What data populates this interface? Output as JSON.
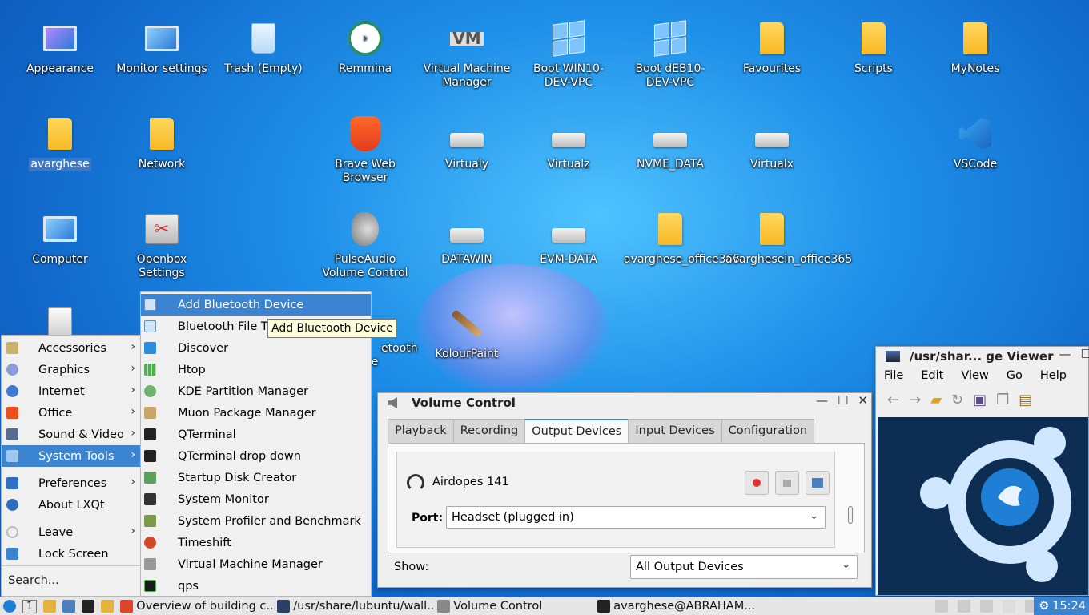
{
  "desktop": {
    "icons": [
      {
        "label": "Appearance"
      },
      {
        "label": "Monitor settings"
      },
      {
        "label": "Trash (Empty)"
      },
      {
        "label": "Remmina"
      },
      {
        "label": "Virtual Machine Manager"
      },
      {
        "label": "Boot WIN10-DEV-VPC"
      },
      {
        "label": "Boot dEB10-DEV-VPC"
      },
      {
        "label": "Favourites"
      },
      {
        "label": "Scripts"
      },
      {
        "label": "MyNotes"
      },
      {
        "label": "avarghese"
      },
      {
        "label": "Network"
      },
      {
        "label": "Brave Web Browser"
      },
      {
        "label": "Virtualy"
      },
      {
        "label": "Virtualz"
      },
      {
        "label": "NVME_DATA"
      },
      {
        "label": "Virtualx"
      },
      {
        "label": "VSCode"
      },
      {
        "label": "Computer"
      },
      {
        "label": "Openbox Settings"
      },
      {
        "label": "PulseAudio Volume Control"
      },
      {
        "label": "DATAWIN"
      },
      {
        "label": "EVM-DATA"
      },
      {
        "label": "avarghese_office365"
      },
      {
        "label": "avarghesein_office365"
      },
      {
        "label": "etooth"
      },
      {
        "label": "ce"
      },
      {
        "label": "KolourPaint"
      }
    ]
  },
  "start_menu": {
    "items": [
      {
        "label": "Accessories"
      },
      {
        "label": "Graphics"
      },
      {
        "label": "Internet"
      },
      {
        "label": "Office"
      },
      {
        "label": "Sound & Video"
      },
      {
        "label": "System Tools"
      },
      {
        "label": "Preferences"
      },
      {
        "label": "About LXQt"
      },
      {
        "label": "Leave"
      },
      {
        "label": "Lock Screen"
      }
    ],
    "search_placeholder": "Search..."
  },
  "system_tools_menu": {
    "items": [
      {
        "label": "Add Bluetooth Device"
      },
      {
        "label": "Bluetooth File Tr"
      },
      {
        "label": "Discover"
      },
      {
        "label": "Htop"
      },
      {
        "label": "KDE Partition Manager"
      },
      {
        "label": "Muon Package Manager"
      },
      {
        "label": "QTerminal"
      },
      {
        "label": "QTerminal drop down"
      },
      {
        "label": "Startup Disk Creator"
      },
      {
        "label": "System Monitor"
      },
      {
        "label": "System Profiler and Benchmark"
      },
      {
        "label": "Timeshift"
      },
      {
        "label": "Virtual Machine Manager"
      },
      {
        "label": "qps"
      }
    ],
    "tooltip": "Add Bluetooth Device"
  },
  "volume_control": {
    "title": "Volume Control",
    "tabs": [
      "Playback",
      "Recording",
      "Output Devices",
      "Input Devices",
      "Configuration"
    ],
    "active_tab": "Output Devices",
    "device_name": "Airdopes 141",
    "port_label": "Port:",
    "port_value": "Headset (plugged in)",
    "show_label": "Show:",
    "show_value": "All Output Devices"
  },
  "image_viewer": {
    "title": "/usr/shar... ge Viewer",
    "menu": [
      "File",
      "Edit",
      "View",
      "Go",
      "Help"
    ]
  },
  "taskbar": {
    "desktop_number": "1",
    "tasks": [
      {
        "label": "Overview of building c..."
      },
      {
        "label": "/usr/share/lubuntu/wall..."
      },
      {
        "label": "Volume Control"
      },
      {
        "label": "avarghese@ABRAHAM..."
      }
    ],
    "clock": "15:24"
  },
  "colors": {
    "accent": "#3a84d2",
    "menu_bg": "#f0f0f0",
    "viewer_bg": "#0d2d53",
    "lubuntu_blue": "#1f7fd6"
  }
}
